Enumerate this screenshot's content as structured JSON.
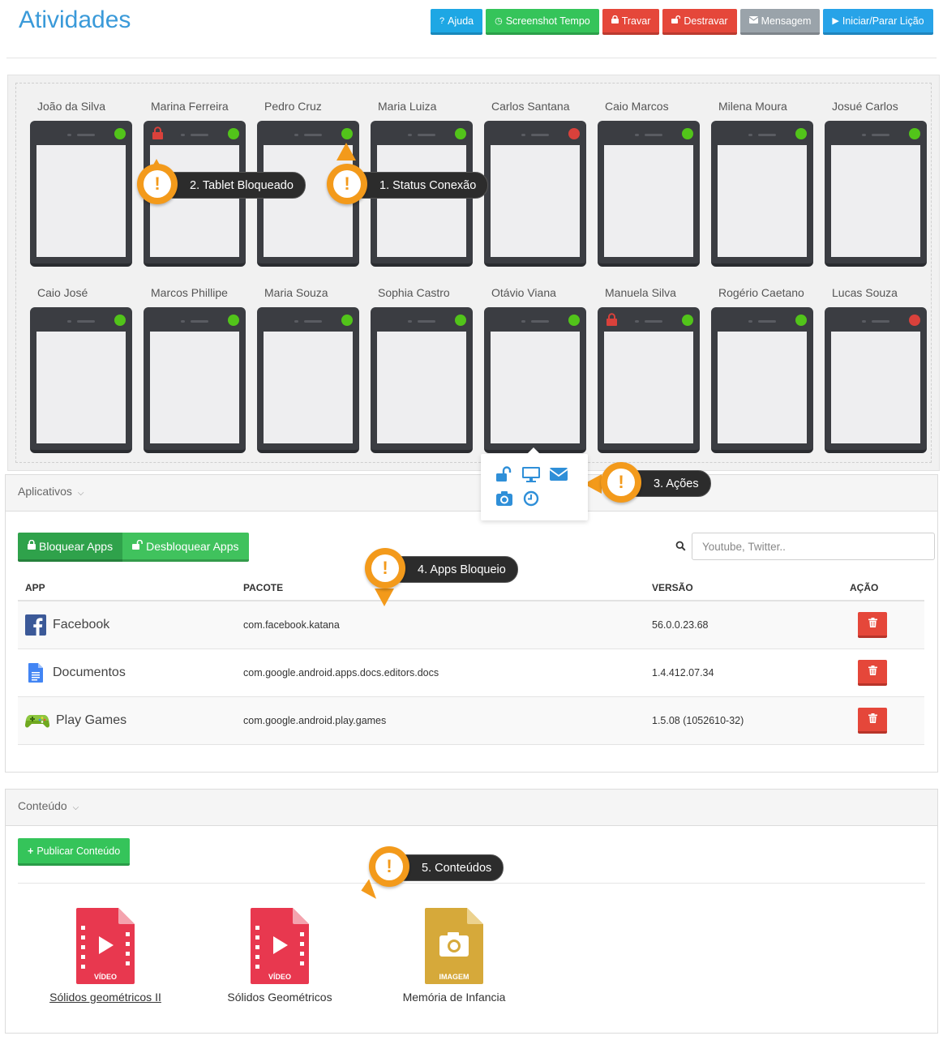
{
  "header": {
    "title": "Atividades",
    "buttons": {
      "help": "Ajuda",
      "screenshot": "Screenshot Tempo",
      "lock": "Travar",
      "unlock": "Destravar",
      "message": "Mensagem",
      "start_stop": "Iniciar/Parar Lição"
    }
  },
  "tablets": [
    {
      "name": "João da Silva",
      "status": "online",
      "locked": false
    },
    {
      "name": "Marina Ferreira",
      "status": "online",
      "locked": true
    },
    {
      "name": "Pedro Cruz",
      "status": "online",
      "locked": false
    },
    {
      "name": "Maria Luiza",
      "status": "online",
      "locked": false
    },
    {
      "name": "Carlos Santana",
      "status": "offline",
      "locked": false
    },
    {
      "name": "Caio Marcos",
      "status": "online",
      "locked": false
    },
    {
      "name": "Milena Moura",
      "status": "online",
      "locked": false
    },
    {
      "name": "Josué Carlos",
      "status": "online",
      "locked": false
    },
    {
      "name": "Caio José",
      "status": "online",
      "locked": false
    },
    {
      "name": "Marcos Phillipe",
      "status": "online",
      "locked": false
    },
    {
      "name": "Maria Souza",
      "status": "online",
      "locked": false
    },
    {
      "name": "Sophia Castro",
      "status": "online",
      "locked": false
    },
    {
      "name": "Otávio Viana",
      "status": "online",
      "locked": false
    },
    {
      "name": "Manuela Silva",
      "status": "online",
      "locked": true
    },
    {
      "name": "Rogério Caetano",
      "status": "online",
      "locked": false
    },
    {
      "name": "Lucas Souza",
      "status": "offline",
      "locked": false
    }
  ],
  "status_colors": {
    "online": "#52c41a",
    "offline": "#d9413b",
    "lock": "#d9413b",
    "accent": "#3a9ad9",
    "callout": "#f39a1b"
  },
  "callouts": {
    "status": "1. Status Conexão",
    "locked": "2. Tablet Bloqueado",
    "actions": "3. Ações",
    "apps": "4. Apps Bloqueio",
    "content": "5. Conteúdos"
  },
  "apps_panel": {
    "title": "Aplicativos",
    "block_label": "Bloquear Apps",
    "unblock_label": "Desbloquear Apps",
    "search_placeholder": "Youtube, Twitter..",
    "columns": {
      "app": "APP",
      "package": "PACOTE",
      "version": "VERSÃO",
      "action": "AÇÃO"
    },
    "rows": [
      {
        "name": "Facebook",
        "package": "com.facebook.katana",
        "version": "56.0.0.23.68",
        "icon": "facebook-icon"
      },
      {
        "name": "Documentos",
        "package": "com.google.android.apps.docs.editors.docs",
        "version": "1.4.412.07.34",
        "icon": "docs-icon"
      },
      {
        "name": "Play Games",
        "package": "com.google.android.play.games",
        "version": "1.5.08 (1052610-32)",
        "icon": "gamepad-icon"
      }
    ]
  },
  "content_panel": {
    "title": "Conteúdo",
    "publish_label": "Publicar Conteúdo",
    "items": [
      {
        "title": "Sólidos geométricos II",
        "type_label": "VÍDEO",
        "kind": "video"
      },
      {
        "title": "Sólidos Geométricos",
        "type_label": "VÍDEO",
        "kind": "video"
      },
      {
        "title": "Memória de Infancia",
        "type_label": "IMAGEM",
        "kind": "image"
      }
    ]
  }
}
